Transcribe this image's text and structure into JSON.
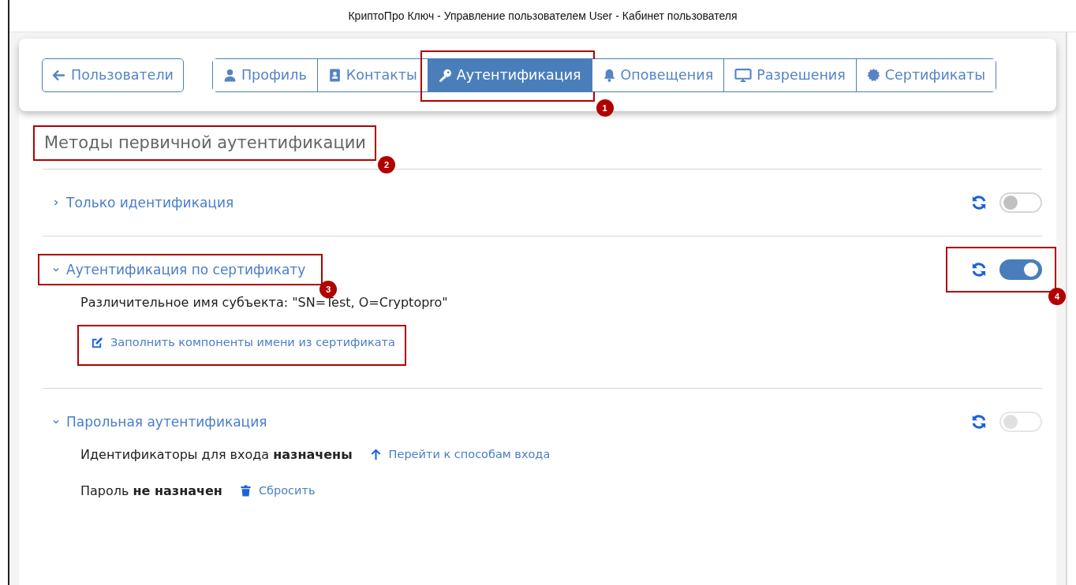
{
  "window": {
    "title": "КриптоПро Ключ - Управление пользователем User - Кабинет пользователя"
  },
  "back_button": {
    "label": "Пользователи"
  },
  "tabs": [
    {
      "label": "Профиль",
      "kind": "person",
      "selected": false
    },
    {
      "label": "Контакты",
      "kind": "contact",
      "selected": false
    },
    {
      "label": "Аутентификация",
      "kind": "key",
      "selected": true,
      "badge": "1"
    },
    {
      "label": "Оповещения",
      "kind": "bell",
      "selected": false
    },
    {
      "label": "Разрешения",
      "kind": "monitor",
      "selected": false
    },
    {
      "label": "Сертификаты",
      "kind": "seal",
      "selected": false
    }
  ],
  "section": {
    "title": "Методы первичной аутентификации",
    "badge": "2"
  },
  "methods": [
    {
      "title": "Только идентификация",
      "expanded": false,
      "toggle": {
        "on": false,
        "disabled": false
      }
    },
    {
      "title": "Аутентификация по сертификату",
      "expanded": true,
      "badge": "3",
      "toggle": {
        "on": true,
        "disabled": false,
        "badge": "4"
      },
      "details": [
        {
          "text": "Различительное имя субъекта: \"SN=Test, O=Cryptopro\""
        },
        {
          "link": {
            "label": "Заполнить компоненты имени из сертификата",
            "kind": "edit",
            "framed": true
          }
        }
      ]
    },
    {
      "title": "Парольная аутентификация",
      "expanded": true,
      "toggle": {
        "on": false,
        "disabled": true
      },
      "details": [
        {
          "text": "Идентификаторы для входа **назначены**",
          "link": {
            "label": "Перейти к способам входа",
            "kind": "arrow-up"
          }
        },
        {
          "text": "Пароль **не назначен**",
          "link": {
            "label": "Сбросить",
            "kind": "trash"
          }
        }
      ]
    }
  ]
}
